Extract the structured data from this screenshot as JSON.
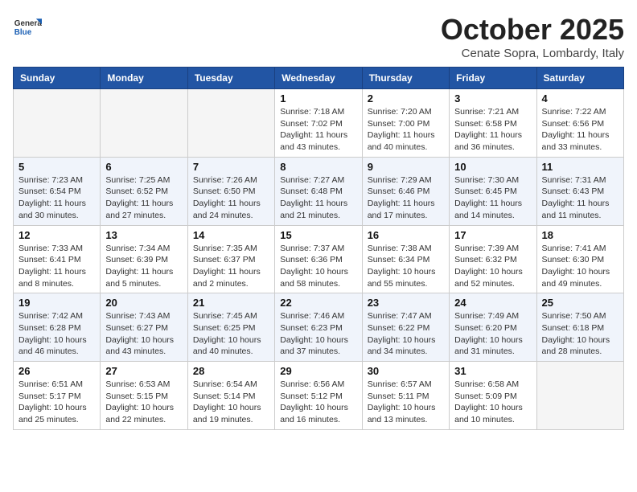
{
  "header": {
    "logo_general": "General",
    "logo_blue": "Blue",
    "month_title": "October 2025",
    "location": "Cenate Sopra, Lombardy, Italy"
  },
  "days_of_week": [
    "Sunday",
    "Monday",
    "Tuesday",
    "Wednesday",
    "Thursday",
    "Friday",
    "Saturday"
  ],
  "weeks": [
    [
      {
        "num": "",
        "info": ""
      },
      {
        "num": "",
        "info": ""
      },
      {
        "num": "",
        "info": ""
      },
      {
        "num": "1",
        "info": "Sunrise: 7:18 AM\nSunset: 7:02 PM\nDaylight: 11 hours and 43 minutes."
      },
      {
        "num": "2",
        "info": "Sunrise: 7:20 AM\nSunset: 7:00 PM\nDaylight: 11 hours and 40 minutes."
      },
      {
        "num": "3",
        "info": "Sunrise: 7:21 AM\nSunset: 6:58 PM\nDaylight: 11 hours and 36 minutes."
      },
      {
        "num": "4",
        "info": "Sunrise: 7:22 AM\nSunset: 6:56 PM\nDaylight: 11 hours and 33 minutes."
      }
    ],
    [
      {
        "num": "5",
        "info": "Sunrise: 7:23 AM\nSunset: 6:54 PM\nDaylight: 11 hours and 30 minutes."
      },
      {
        "num": "6",
        "info": "Sunrise: 7:25 AM\nSunset: 6:52 PM\nDaylight: 11 hours and 27 minutes."
      },
      {
        "num": "7",
        "info": "Sunrise: 7:26 AM\nSunset: 6:50 PM\nDaylight: 11 hours and 24 minutes."
      },
      {
        "num": "8",
        "info": "Sunrise: 7:27 AM\nSunset: 6:48 PM\nDaylight: 11 hours and 21 minutes."
      },
      {
        "num": "9",
        "info": "Sunrise: 7:29 AM\nSunset: 6:46 PM\nDaylight: 11 hours and 17 minutes."
      },
      {
        "num": "10",
        "info": "Sunrise: 7:30 AM\nSunset: 6:45 PM\nDaylight: 11 hours and 14 minutes."
      },
      {
        "num": "11",
        "info": "Sunrise: 7:31 AM\nSunset: 6:43 PM\nDaylight: 11 hours and 11 minutes."
      }
    ],
    [
      {
        "num": "12",
        "info": "Sunrise: 7:33 AM\nSunset: 6:41 PM\nDaylight: 11 hours and 8 minutes."
      },
      {
        "num": "13",
        "info": "Sunrise: 7:34 AM\nSunset: 6:39 PM\nDaylight: 11 hours and 5 minutes."
      },
      {
        "num": "14",
        "info": "Sunrise: 7:35 AM\nSunset: 6:37 PM\nDaylight: 11 hours and 2 minutes."
      },
      {
        "num": "15",
        "info": "Sunrise: 7:37 AM\nSunset: 6:36 PM\nDaylight: 10 hours and 58 minutes."
      },
      {
        "num": "16",
        "info": "Sunrise: 7:38 AM\nSunset: 6:34 PM\nDaylight: 10 hours and 55 minutes."
      },
      {
        "num": "17",
        "info": "Sunrise: 7:39 AM\nSunset: 6:32 PM\nDaylight: 10 hours and 52 minutes."
      },
      {
        "num": "18",
        "info": "Sunrise: 7:41 AM\nSunset: 6:30 PM\nDaylight: 10 hours and 49 minutes."
      }
    ],
    [
      {
        "num": "19",
        "info": "Sunrise: 7:42 AM\nSunset: 6:28 PM\nDaylight: 10 hours and 46 minutes."
      },
      {
        "num": "20",
        "info": "Sunrise: 7:43 AM\nSunset: 6:27 PM\nDaylight: 10 hours and 43 minutes."
      },
      {
        "num": "21",
        "info": "Sunrise: 7:45 AM\nSunset: 6:25 PM\nDaylight: 10 hours and 40 minutes."
      },
      {
        "num": "22",
        "info": "Sunrise: 7:46 AM\nSunset: 6:23 PM\nDaylight: 10 hours and 37 minutes."
      },
      {
        "num": "23",
        "info": "Sunrise: 7:47 AM\nSunset: 6:22 PM\nDaylight: 10 hours and 34 minutes."
      },
      {
        "num": "24",
        "info": "Sunrise: 7:49 AM\nSunset: 6:20 PM\nDaylight: 10 hours and 31 minutes."
      },
      {
        "num": "25",
        "info": "Sunrise: 7:50 AM\nSunset: 6:18 PM\nDaylight: 10 hours and 28 minutes."
      }
    ],
    [
      {
        "num": "26",
        "info": "Sunrise: 6:51 AM\nSunset: 5:17 PM\nDaylight: 10 hours and 25 minutes."
      },
      {
        "num": "27",
        "info": "Sunrise: 6:53 AM\nSunset: 5:15 PM\nDaylight: 10 hours and 22 minutes."
      },
      {
        "num": "28",
        "info": "Sunrise: 6:54 AM\nSunset: 5:14 PM\nDaylight: 10 hours and 19 minutes."
      },
      {
        "num": "29",
        "info": "Sunrise: 6:56 AM\nSunset: 5:12 PM\nDaylight: 10 hours and 16 minutes."
      },
      {
        "num": "30",
        "info": "Sunrise: 6:57 AM\nSunset: 5:11 PM\nDaylight: 10 hours and 13 minutes."
      },
      {
        "num": "31",
        "info": "Sunrise: 6:58 AM\nSunset: 5:09 PM\nDaylight: 10 hours and 10 minutes."
      },
      {
        "num": "",
        "info": ""
      }
    ]
  ]
}
